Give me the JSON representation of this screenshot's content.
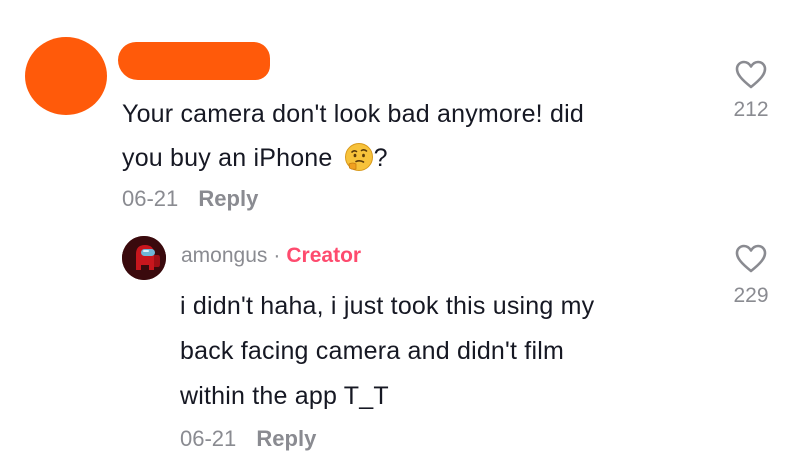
{
  "comment": {
    "text_line1": "Your camera don't look bad anymore! did",
    "text_line2_pre": "you buy an iPhone ",
    "text_line2_post": "?",
    "emoji_icon": "thinking-face-icon",
    "date": "06-21",
    "reply_label": "Reply",
    "likes": "212"
  },
  "reply": {
    "username": "amongus",
    "separator": "·",
    "badge": "Creator",
    "text_line1": "i didn't haha, i just took this using my",
    "text_line2": "back facing camera and didn't film",
    "text_line3": "within the app T_T",
    "date": "06-21",
    "reply_label": "Reply",
    "likes": "229"
  },
  "colors": {
    "redaction": "#ff5a0a",
    "creator_badge": "#fe2c55",
    "meta_gray": "#8a8b91"
  }
}
